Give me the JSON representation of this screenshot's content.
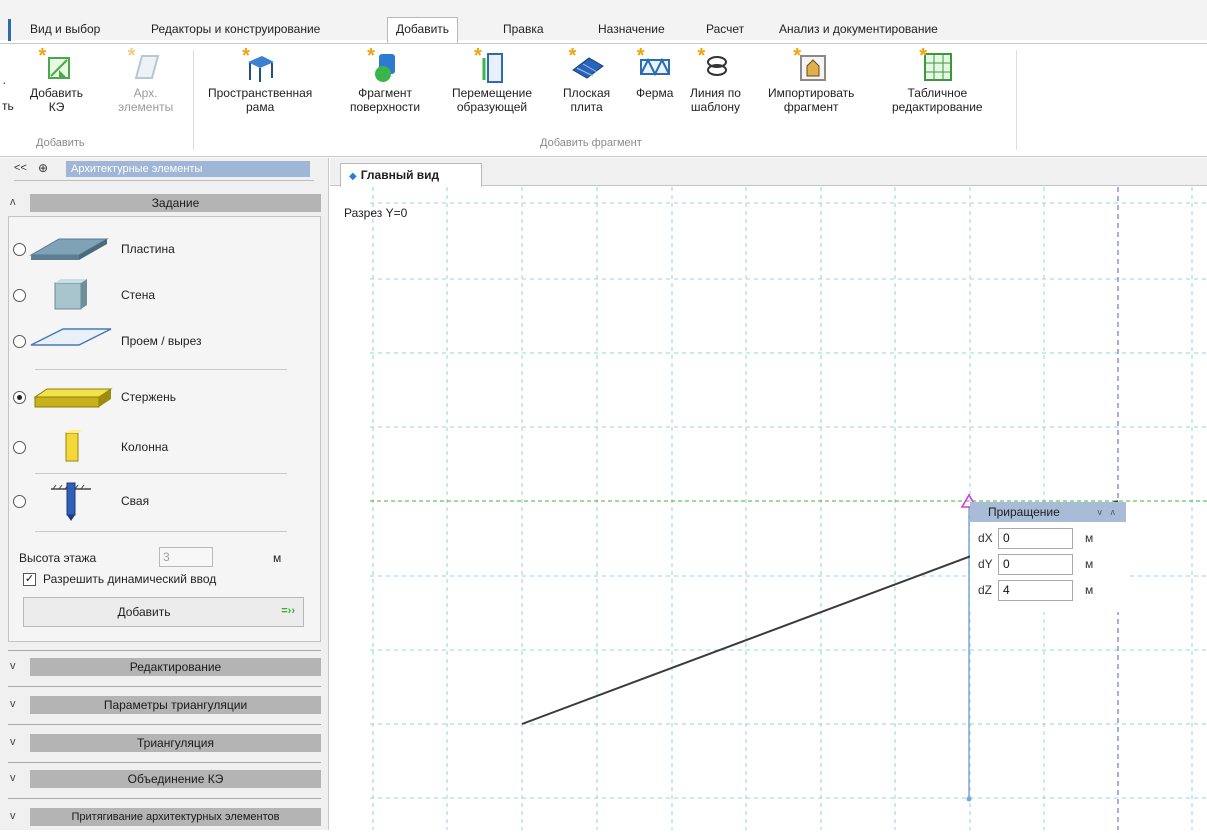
{
  "menu": {
    "tabs": [
      "Вид и выбор",
      "Редакторы и конструирование",
      "Добавить",
      "Правка",
      "Назначение",
      "Расчет",
      "Анализ и документирование"
    ],
    "active_tab": "Добавить"
  },
  "ribbon": {
    "cut_label": "ть",
    "buttons": [
      {
        "label": "Добавить\nКЭ",
        "icon": "add-fe-icon"
      },
      {
        "label": "Арх.\nэлементы",
        "icon": "arch-elements-icon",
        "disabled": true
      },
      {
        "label": "Пространственная\nрама",
        "icon": "spatial-frame-icon"
      },
      {
        "label": "Фрагмент\nповерхности",
        "icon": "surface-fragment-icon"
      },
      {
        "label": "Перемещение\nобразующей",
        "icon": "generatrix-move-icon"
      },
      {
        "label": "Плоская\nплита",
        "icon": "flat-slab-icon"
      },
      {
        "label": "Ферма",
        "icon": "truss-icon"
      },
      {
        "label": "Линия по\nшаблону",
        "icon": "template-line-icon"
      },
      {
        "label": "Импортировать\nфрагмент",
        "icon": "import-fragment-icon"
      },
      {
        "label": "Табличное\nредактирование",
        "icon": "table-edit-icon"
      }
    ],
    "group_add": "Добавить",
    "group_fragment": "Добавить фрагмент"
  },
  "panel": {
    "collapse": "<<",
    "pin": "⊕",
    "title": "Архитектурные элементы",
    "zadanie": "Задание",
    "options": [
      {
        "label": "Пластина",
        "selected": false
      },
      {
        "label": "Стена",
        "selected": false
      },
      {
        "label": "Проем / вырез",
        "selected": false
      },
      {
        "label": "Стержень",
        "selected": true
      },
      {
        "label": "Колонна",
        "selected": false
      },
      {
        "label": "Свая",
        "selected": false
      }
    ],
    "floor_height_label": "Высота этажа",
    "floor_height_value": "3",
    "floor_height_unit": "м",
    "dynamic_input_label": "Разрешить динамический ввод",
    "dynamic_input_checked": true,
    "add_button": "Добавить",
    "add_arrow": "»",
    "sections": [
      "Редактирование",
      "Параметры триангуляции",
      "Триангуляция",
      "Объединение КЭ",
      "Притягивание архитектурных элементов"
    ]
  },
  "view": {
    "tab": "Главный вид",
    "section_label": "Разрез Y=0"
  },
  "increment": {
    "title": "Приращение",
    "arrows": "v ʌ",
    "rows": [
      {
        "key": "dX",
        "value": "0",
        "unit": "м"
      },
      {
        "key": "dY",
        "value": "0",
        "unit": "м"
      },
      {
        "key": "dZ",
        "value": "4",
        "unit": "м"
      }
    ]
  },
  "colors": {
    "grid": "#9ad0e0",
    "accent_green": "#3cb33c",
    "axis_blue": "#7aa7d9",
    "magenta": "#d63bd6",
    "line": "#3a3a3a"
  }
}
